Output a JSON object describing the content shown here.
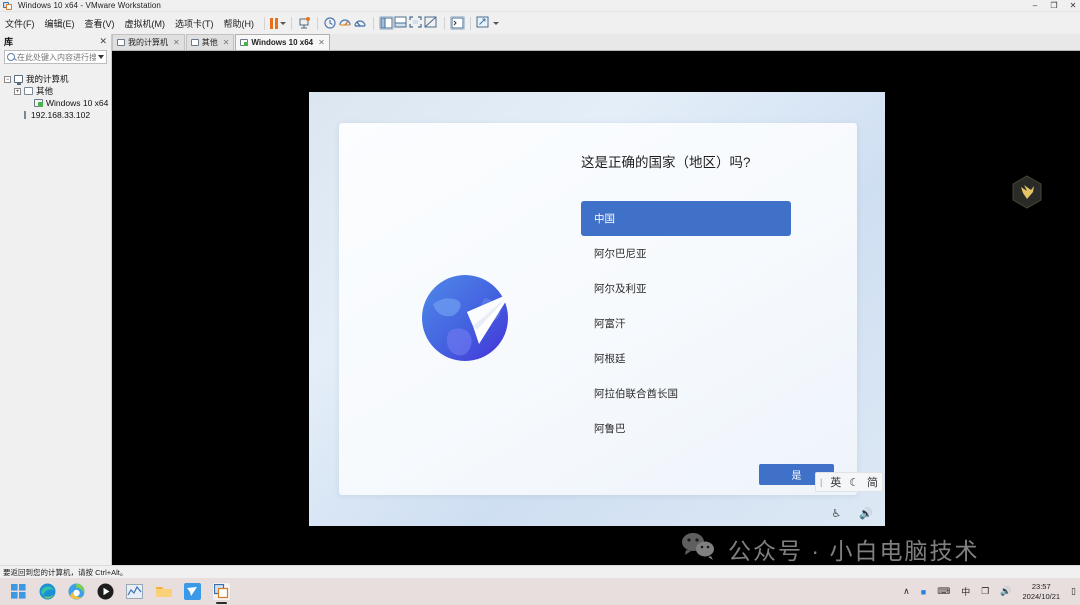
{
  "window": {
    "title": "Windows 10 x64 - VMware Workstation",
    "app_icon": "vmware-icon",
    "minimize": "–",
    "maximize": "❐",
    "close": "✕"
  },
  "menubar": {
    "items": [
      {
        "label": "文件(F)",
        "name": "menu-file"
      },
      {
        "label": "编辑(E)",
        "name": "menu-edit"
      },
      {
        "label": "查看(V)",
        "name": "menu-view"
      },
      {
        "label": "虚拟机(M)",
        "name": "menu-vm"
      },
      {
        "label": "选项卡(T)",
        "name": "menu-tabs"
      },
      {
        "label": "帮助(H)",
        "name": "menu-help"
      }
    ],
    "tools": [
      {
        "name": "pause-button",
        "title": "暂停"
      },
      {
        "name": "pause-dropdown",
        "title": "暂停下拉"
      },
      {
        "name": "send-ctrl-alt-del-button",
        "title": "发送 Ctrl+Alt+Del"
      },
      {
        "name": "snapshot-button",
        "title": "快照"
      },
      {
        "name": "revert-snapshot-button",
        "title": "恢复快照"
      },
      {
        "name": "snapshot-manager-button",
        "title": "快照管理器"
      },
      {
        "name": "show-library-button",
        "title": "显示库"
      },
      {
        "name": "show-thumbnail-bar-button",
        "title": "显示缩略图栏"
      },
      {
        "name": "full-screen-button",
        "title": "全屏"
      },
      {
        "name": "unity-mode-button",
        "title": "Unity 模式"
      },
      {
        "name": "console-button",
        "title": "控制台"
      },
      {
        "name": "stretch-button",
        "title": "拉伸"
      },
      {
        "name": "stretch-dropdown",
        "title": "拉伸下拉"
      }
    ]
  },
  "sidebar": {
    "title": "库",
    "close_label": "✕",
    "search": {
      "placeholder": "在此处键入内容进行搜索",
      "value": ""
    },
    "tree": [
      {
        "label": "我的计算机",
        "icon": "computer-icon",
        "indent": 0,
        "expander": "−"
      },
      {
        "label": "其他",
        "icon": "folder-icon",
        "indent": 1,
        "expander": "+"
      },
      {
        "label": "Windows 10 x64",
        "icon": "vm-icon",
        "indent": 2,
        "expander": ""
      },
      {
        "label": "192.168.33.102",
        "icon": "host-icon",
        "indent": 1,
        "expander": ""
      }
    ]
  },
  "tabs": [
    {
      "label": "我的计算机",
      "active": false,
      "close": "✕",
      "icon": "monitor-icon"
    },
    {
      "label": "其他",
      "active": false,
      "close": "✕",
      "icon": "folder-icon"
    },
    {
      "label": "Windows 10 x64",
      "active": true,
      "close": "✕",
      "icon": "vm-running-icon"
    }
  ],
  "oobe": {
    "question": "这是正确的国家（地区）吗?",
    "graphic": "globe-paper-plane-icon",
    "countries": [
      {
        "name": "中国",
        "selected": true
      },
      {
        "name": "阿尔巴尼亚",
        "selected": false
      },
      {
        "name": "阿尔及利亚",
        "selected": false
      },
      {
        "name": "阿富汗",
        "selected": false
      },
      {
        "name": "阿根廷",
        "selected": false
      },
      {
        "name": "阿拉伯联合酋长国",
        "selected": false
      },
      {
        "name": "阿鲁巴",
        "selected": false
      }
    ],
    "confirm_button": "是",
    "ime": {
      "separator": "|",
      "language": "英",
      "mode_icon": "☾",
      "script": "简"
    },
    "tray": [
      {
        "name": "accessibility-icon",
        "glyph": "♿"
      },
      {
        "name": "volume-icon",
        "glyph": "🔊"
      }
    ],
    "accent_color": "#3f71c8",
    "badge": "hex-bird-icon"
  },
  "watermark": {
    "icon": "wechat-icon",
    "text": "公众号 · 小白电脑技术"
  },
  "statusbar": {
    "message": "要返回到您的计算机，请按 Ctrl+Alt。"
  },
  "taskbar": {
    "apps": [
      {
        "name": "start-button",
        "icon": "windows-logo-icon",
        "active": false
      },
      {
        "name": "edge-button",
        "icon": "edge-icon",
        "active": false
      },
      {
        "name": "browser-360-button",
        "icon": "browser-icon",
        "active": false
      },
      {
        "name": "media-player-button",
        "icon": "play-icon",
        "active": false
      },
      {
        "name": "chart-app-button",
        "icon": "chart-icon",
        "active": false
      },
      {
        "name": "file-explorer-button",
        "icon": "folder-icon",
        "active": false
      },
      {
        "name": "mail-app-button",
        "icon": "bird-icon",
        "active": false
      },
      {
        "name": "vmware-button",
        "icon": "vmware-icon",
        "active": true
      }
    ],
    "tray": [
      {
        "name": "show-hidden-icons-button",
        "glyph": "∧"
      },
      {
        "name": "app-tray-icon",
        "glyph": "■"
      },
      {
        "name": "keyboard-icon",
        "glyph": "⌨"
      },
      {
        "name": "ime-chinese-indicator",
        "glyph": "中"
      },
      {
        "name": "display-icon",
        "glyph": "❐"
      },
      {
        "name": "volume-icon",
        "glyph": "🔊"
      }
    ],
    "clock": {
      "time": "23:57",
      "date": "2024/10/21"
    },
    "notification_icon": "notification-icon"
  }
}
